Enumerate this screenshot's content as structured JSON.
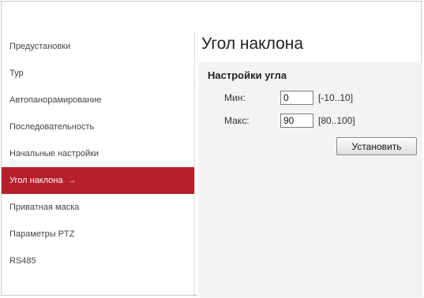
{
  "sidebar": {
    "items": [
      {
        "label": "Предустановки"
      },
      {
        "label": "Тур"
      },
      {
        "label": "Автопанорамирование"
      },
      {
        "label": "Последовательность"
      },
      {
        "label": "Начальные настройки"
      },
      {
        "label": "Угол наклона",
        "active": true,
        "marker": "→"
      },
      {
        "label": "Приватная маска"
      },
      {
        "label": "Параметры PTZ"
      },
      {
        "label": "RS485"
      }
    ]
  },
  "page": {
    "title": "Угол наклона",
    "section_title": "Настройки угла"
  },
  "form": {
    "min": {
      "label": "Мин:",
      "value": "0",
      "range": "[-10..10]"
    },
    "max": {
      "label": "Макс:",
      "value": "90",
      "range": "[80..100]"
    },
    "submit_label": "Установить"
  },
  "colors": {
    "active_item": "#b61f2b",
    "panel_bg": "#f3f3f3"
  }
}
